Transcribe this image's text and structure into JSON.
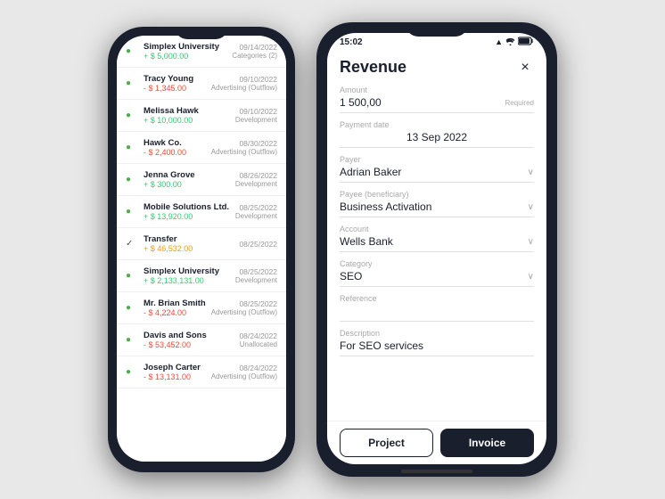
{
  "left_phone": {
    "transactions": [
      {
        "icon": "dot",
        "name": "Simplex University",
        "amount": "+ $ 5,000.00",
        "amountType": "positive",
        "date": "09/14/2022",
        "category": "Categories (2)"
      },
      {
        "icon": "dot",
        "name": "Tracy Young",
        "amount": "- $ 1,345.00",
        "amountType": "negative",
        "date": "09/10/2022",
        "category": "Advertising (Outflow)"
      },
      {
        "icon": "dot",
        "name": "Melissa Hawk",
        "amount": "+ $ 10,000.00",
        "amountType": "positive",
        "date": "09/10/2022",
        "category": "Development"
      },
      {
        "icon": "dot",
        "name": "Hawk Co.",
        "amount": "- $ 2,400.00",
        "amountType": "negative",
        "date": "08/30/2022",
        "category": "Advertising (Outflow)"
      },
      {
        "icon": "dot",
        "name": "Jenna Grove",
        "amount": "+ $ 300.00",
        "amountType": "positive",
        "date": "08/26/2022",
        "category": "Development"
      },
      {
        "icon": "dot",
        "name": "Mobile Solutions Ltd.",
        "amount": "+ $ 13,920.00",
        "amountType": "positive",
        "date": "08/25/2022",
        "category": "Development"
      },
      {
        "icon": "check",
        "name": "Transfer",
        "amount": "+ $ 46,532.00",
        "amountType": "transfer",
        "date": "08/25/2022",
        "category": ""
      },
      {
        "icon": "dot",
        "name": "Simplex University",
        "amount": "+ $ 2,133,131.00",
        "amountType": "positive",
        "date": "08/25/2022",
        "category": "Development"
      },
      {
        "icon": "dot",
        "name": "Mr. Brian Smith",
        "amount": "- $ 4,224.00",
        "amountType": "negative",
        "date": "08/25/2022",
        "category": "Advertising (Outflow)"
      },
      {
        "icon": "dot",
        "name": "Davis and Sons",
        "amount": "- $ 53,452.00",
        "amountType": "negative",
        "date": "08/24/2022",
        "category": "Unallocated"
      },
      {
        "icon": "dot",
        "name": "Joseph Carter",
        "amount": "- $ 13,131.00",
        "amountType": "negative",
        "date": "08/24/2022",
        "category": "Advertising (Outflow)"
      }
    ]
  },
  "right_phone": {
    "status_bar": {
      "time": "15:02",
      "signal_icon": "▲",
      "wifi_icon": "wifi",
      "battery_icon": "▬"
    },
    "modal": {
      "title": "Revenue",
      "close_label": "×",
      "fields": {
        "amount": {
          "label": "Amount",
          "value": "1 500,00",
          "required": "Required"
        },
        "payment_date": {
          "label": "Payment date",
          "value": "13 Sep 2022"
        },
        "payer": {
          "label": "Payer",
          "value": "Adrian Baker"
        },
        "payee": {
          "label": "Payee (beneficiary)",
          "value": "Business Activation"
        },
        "account": {
          "label": "Account",
          "value": "Wells Bank"
        },
        "category": {
          "label": "Category",
          "value": "SEO"
        },
        "reference": {
          "label": "Reference",
          "value": ""
        },
        "description": {
          "label": "Description",
          "value": "For SEO services"
        }
      },
      "footer": {
        "project_label": "Project",
        "invoice_label": "Invoice"
      }
    }
  }
}
